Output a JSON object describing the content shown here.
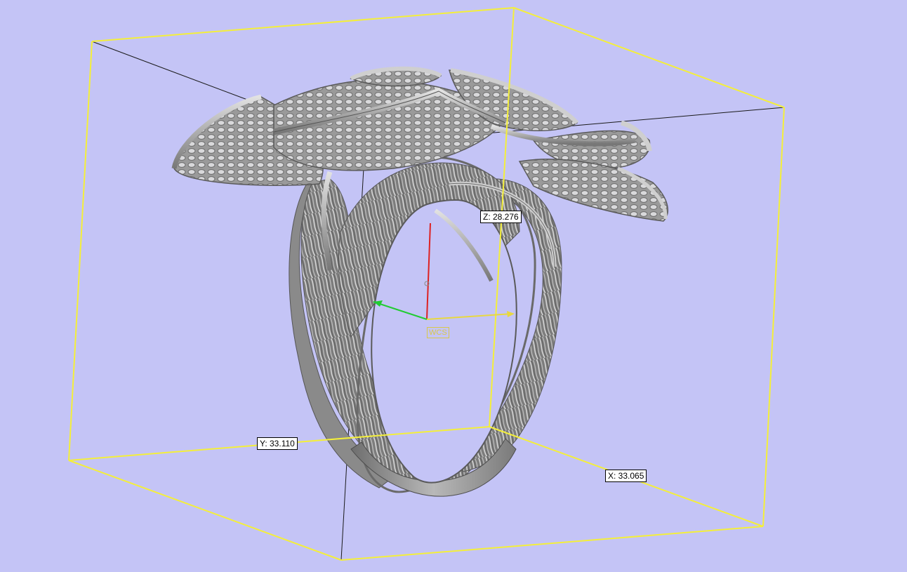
{
  "viewport": {
    "background_color": "#c4c4f6",
    "bounding_box_color": "#f4ef3a",
    "model_color": "#8f8f8f"
  },
  "dimensions": {
    "z_label": "Z: 28.276",
    "y_label": "Y: 33.110",
    "x_label": "X: 33.065"
  },
  "triad": {
    "label": "WCS",
    "x_axis_color": "#e8d840",
    "y_axis_color": "#22cc33",
    "z_axis_color": "#dd2222"
  },
  "model": {
    "icon": "filigree-ring-model"
  }
}
